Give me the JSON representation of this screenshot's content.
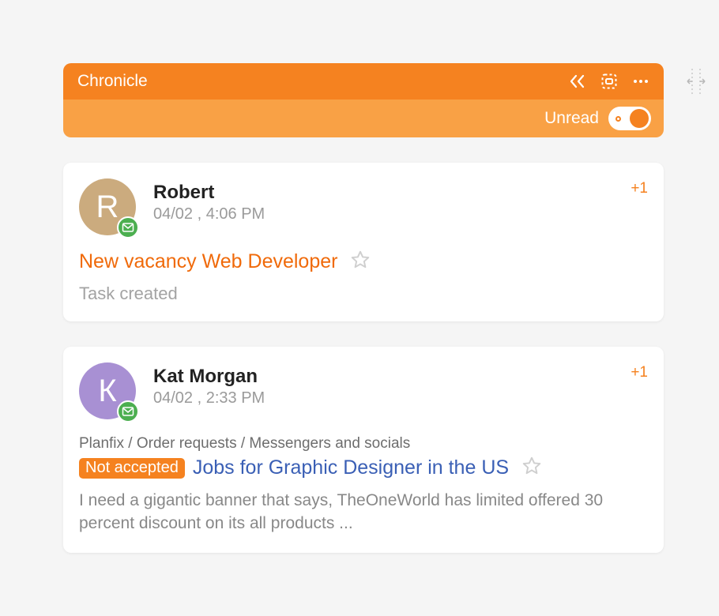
{
  "header": {
    "title": "Chronicle",
    "unread_label": "Unread"
  },
  "items": [
    {
      "avatar_initial": "R",
      "avatar_color": "tan",
      "name": "Robert",
      "timestamp": "04/02 , 4:06 PM",
      "plus_count": "+1",
      "subject": "New vacancy Web Developer",
      "subject_style": "orange",
      "status": "Task created"
    },
    {
      "avatar_initial": "К",
      "avatar_color": "purple",
      "name": "Kat Morgan",
      "timestamp": "04/02 , 2:33 PM",
      "plus_count": "+1",
      "breadcrumb": "Planfix / Order requests / Messengers and socials",
      "badge": "Not accepted",
      "subject": "Jobs for Graphic Designer in the US",
      "subject_style": "blue",
      "preview": "I need a gigantic banner that says, TheOneWorld has limited offered 30 percent discount on its all products ..."
    }
  ]
}
